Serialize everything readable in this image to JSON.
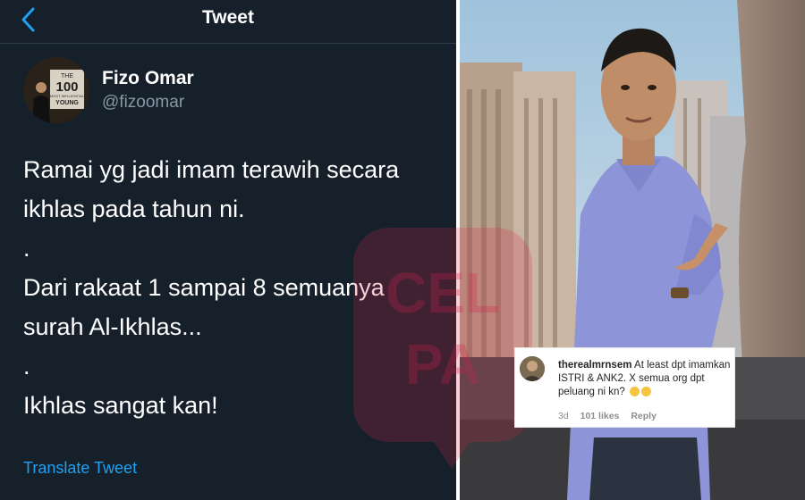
{
  "tweet": {
    "header_title": "Tweet",
    "author_name": "Fizo Omar",
    "author_handle": "@fizoomar",
    "avatar_text": {
      "top": "THE",
      "number": "100",
      "line1": "MOST INFLUENTIAL",
      "line2": "YOUNG"
    },
    "lines": [
      "Ramai yg jadi imam terawih secara",
      "ikhlas pada tahun ni.",
      ".",
      "Dari rakaat 1 sampai 8 semuanya",
      "surah Al-Ikhlas...",
      ".",
      "Ikhlas sangat kan!"
    ],
    "translate_label": "Translate Tweet"
  },
  "watermark": {
    "line1": "CEL",
    "line2": "PA"
  },
  "instagram_comment": {
    "username": "therealmrnsem",
    "text": "At least dpt imamkan ISTRI & ANK2. X semua org dpt peluang ni kn?",
    "time": "3d",
    "likes": "101 likes",
    "reply_label": "Reply"
  },
  "colors": {
    "tweet_bg": "#15202b",
    "tweet_link": "#1da1f2",
    "handle": "#8899a6",
    "shirt": "#8d94d8"
  }
}
